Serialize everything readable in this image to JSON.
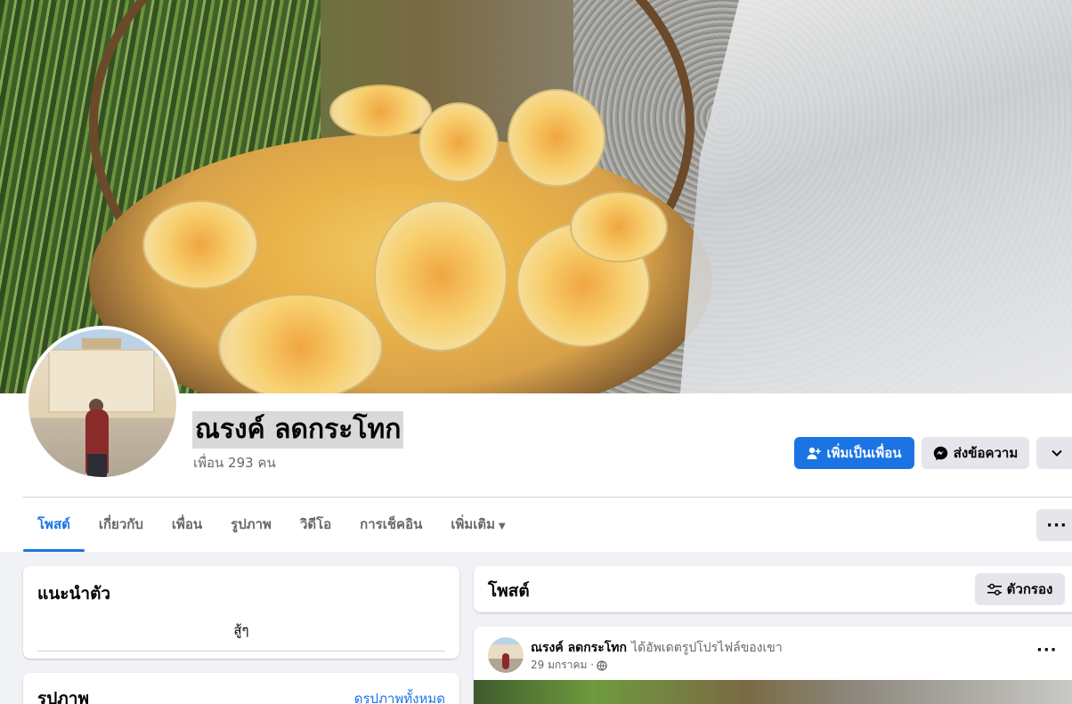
{
  "profile": {
    "name": "ณรงค์ ลดกระโทก",
    "friends_count": "เพื่อน 293 คน"
  },
  "actions": {
    "add_friend": "เพิ่มเป็นเพื่อน",
    "message": "ส่งข้อความ"
  },
  "tabs": [
    {
      "label": "โพสต์",
      "active": true
    },
    {
      "label": "เกี่ยวกับ"
    },
    {
      "label": "เพื่อน"
    },
    {
      "label": "รูปภาพ"
    },
    {
      "label": "วิดีโอ"
    },
    {
      "label": "การเช็คอิน"
    },
    {
      "label": "เพิ่มเติม"
    }
  ],
  "intro": {
    "title": "แนะนำตัว",
    "bio": "สู้ๆ"
  },
  "photos": {
    "title": "รูปภาพ",
    "see_all": "ดูรูปภาพทั้งหมด"
  },
  "posts": {
    "title": "โพสต์",
    "filter_label": "ตัวกรอง",
    "items": [
      {
        "author": "ณรงค์ ลดกระโทก",
        "action": "ได้อัพเดตรูปโปรไฟล์ของเขา",
        "date": "29 มกราคม ·"
      }
    ]
  },
  "colors": {
    "accent": "#1b74e4",
    "background": "#f0f2f5",
    "button_gray": "#e4e6eb",
    "muted_text": "#65676b"
  }
}
